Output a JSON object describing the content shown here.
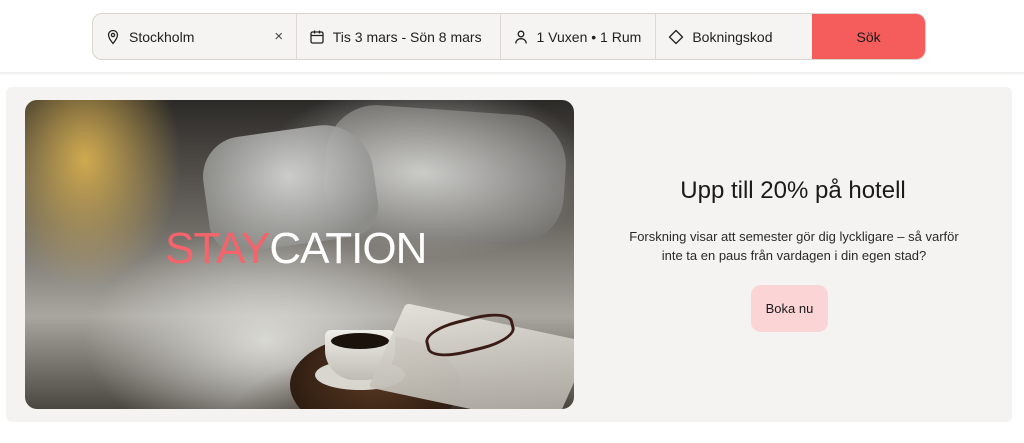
{
  "search": {
    "location": "Stockholm",
    "dates": "Tis 3 mars - Sön 8 mars",
    "guests": "1 Vuxen • 1 Rum",
    "booking_code_placeholder": "Bokningskod",
    "search_label": "Sök",
    "clear_symbol": "×",
    "icons": {
      "location": "map-pin-icon",
      "dates": "calendar-icon",
      "guests": "person-icon",
      "code": "tag-icon",
      "clear": "close-icon"
    }
  },
  "promo": {
    "hero_word_accent": "STAY",
    "hero_word_rest": "CATION",
    "title": "Upp till 20% på hotell",
    "description": "Forskning visar att semester gör dig lyckligare – så varför inte ta en paus från vardagen i din egen stad?",
    "cta_label": "Boka nu"
  },
  "colors": {
    "accent": "#f55c5c",
    "cta_bg": "#fbd4d5",
    "panel_bg": "#f4f3f1"
  }
}
